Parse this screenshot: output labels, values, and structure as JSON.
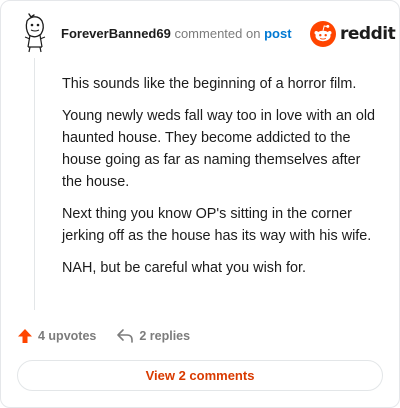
{
  "comment": {
    "username": "ForeverBanned69",
    "action_text": "commented on",
    "post_link": "post",
    "paragraphs": [
      "This sounds like the beginning of a horror film.",
      "Young newly weds fall way too in love with an old haunted house. They become addicted to the house going as far as naming themselves after the house.",
      "Next thing you know OP's sitting in the corner jerking off as the house has its way with his wife.",
      "NAH, but be careful what you wish for."
    ]
  },
  "brand": {
    "wordmark": "reddit",
    "color": "#ff4500"
  },
  "actions": {
    "upvotes_label": "4 upvotes",
    "replies_label": "2 replies"
  },
  "footer": {
    "view_comments_label": "View 2 comments"
  },
  "colors": {
    "accent": "#ff4500",
    "link": "#0079d3",
    "button_text": "#d93a00"
  }
}
